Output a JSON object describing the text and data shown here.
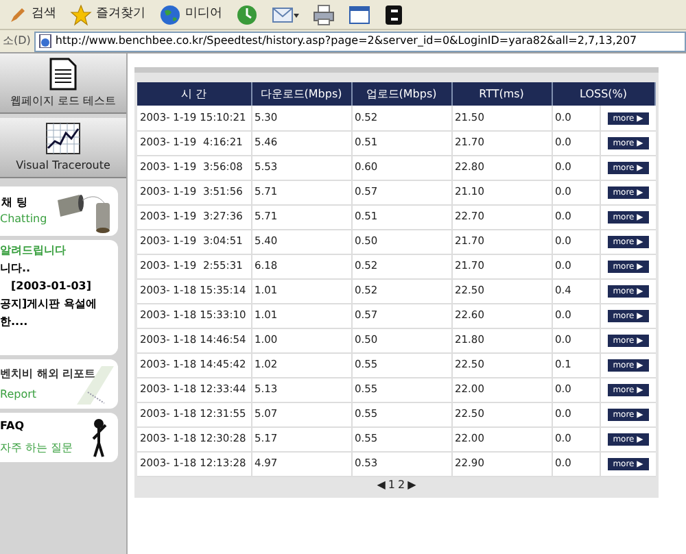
{
  "toolbar": {
    "buttons": [
      {
        "kind": "search",
        "label": "검색"
      },
      {
        "kind": "favorites",
        "label": "즐겨찾기"
      },
      {
        "kind": "media",
        "label": "미디어"
      }
    ]
  },
  "address_bar": {
    "label": "소(D)",
    "url": "http://www.benchbee.co.kr/Speedtest/history.asp?page=2&server_id=0&LoginID=yara82&all=2,7,13,207"
  },
  "sidebar": {
    "menu": [
      {
        "kind": "document",
        "label": "웹페이지 로드 테스트"
      },
      {
        "kind": "chart",
        "label": "Visual Traceroute"
      }
    ],
    "chat": {
      "title": "채 팅",
      "subtitle": "Chatting"
    },
    "notice": {
      "title": "알려드립니다",
      "lines": [
        "니다..",
        "[2003-01-03]",
        "공지]게시판 욕설에",
        "한...."
      ]
    },
    "report": {
      "title": "벤치비 해외 리포트",
      "subtitle": "Report"
    },
    "faq": {
      "title": "FAQ",
      "subtitle": "자주 하는 질문"
    }
  },
  "table": {
    "columns": [
      "시 간",
      "다운로드(Mbps)",
      "업로드(Mbps)",
      "RTT(ms)",
      "LOSS(%)"
    ],
    "rows": [
      [
        "2003- 1-19 15:10:21",
        "5.30",
        "0.52",
        "21.50",
        "0.0"
      ],
      [
        "2003- 1-19  4:16:21",
        "5.46",
        "0.51",
        "21.70",
        "0.0"
      ],
      [
        "2003- 1-19  3:56:08",
        "5.53",
        "0.60",
        "22.80",
        "0.0"
      ],
      [
        "2003- 1-19  3:51:56",
        "5.71",
        "0.57",
        "21.10",
        "0.0"
      ],
      [
        "2003- 1-19  3:27:36",
        "5.71",
        "0.51",
        "22.70",
        "0.0"
      ],
      [
        "2003- 1-19  3:04:51",
        "5.40",
        "0.50",
        "21.70",
        "0.0"
      ],
      [
        "2003- 1-19  2:55:31",
        "6.18",
        "0.52",
        "21.70",
        "0.0"
      ],
      [
        "2003- 1-18 15:35:14",
        "1.01",
        "0.52",
        "22.50",
        "0.4"
      ],
      [
        "2003- 1-18 15:33:10",
        "1.01",
        "0.57",
        "22.60",
        "0.0"
      ],
      [
        "2003- 1-18 14:46:54",
        "1.00",
        "0.50",
        "21.80",
        "0.0"
      ],
      [
        "2003- 1-18 14:45:42",
        "1.02",
        "0.55",
        "22.50",
        "0.1"
      ],
      [
        "2003- 1-18 12:33:44",
        "5.13",
        "0.55",
        "22.00",
        "0.0"
      ],
      [
        "2003- 1-18 12:31:55",
        "5.07",
        "0.55",
        "22.50",
        "0.0"
      ],
      [
        "2003- 1-18 12:30:28",
        "5.17",
        "0.55",
        "22.00",
        "0.0"
      ],
      [
        "2003- 1-18 12:13:28",
        "4.97",
        "0.53",
        "22.90",
        "0.0"
      ]
    ],
    "row_buttons": [
      "more ▶",
      "more ▶",
      "more ▶",
      "more ▶",
      "more ▶",
      "more ▶",
      "more ▶",
      "more ▶",
      "more ▶",
      "more ▶",
      "more ▶",
      "more ▶",
      "more ▶",
      "more ▶",
      "more ▶"
    ],
    "pager": {
      "prev": "◀",
      "pages": [
        "1",
        "2"
      ],
      "next": "▶"
    }
  }
}
